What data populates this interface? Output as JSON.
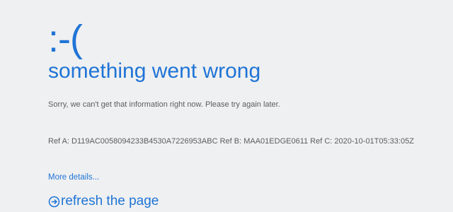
{
  "error": {
    "face": ":-(",
    "title": "something went wrong",
    "message": "Sorry, we can't get that information right now. Please try again later.",
    "reference": "Ref A: D119AC0058094233B4530A7226953ABC Ref B: MAA01EDGE0611 Ref C: 2020-10-01T05:33:05Z",
    "more_details": "More details...",
    "refresh_label": "refresh the page"
  },
  "colors": {
    "accent": "#1f74d6",
    "text": "#5d5d5d",
    "background": "#eff0f1"
  },
  "icons": {
    "refresh": "arrow-circle-right-icon"
  }
}
